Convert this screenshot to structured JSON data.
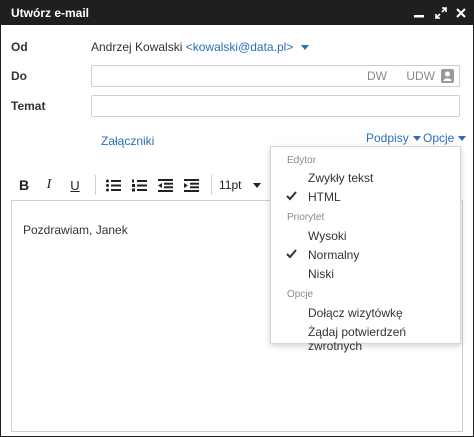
{
  "window": {
    "title": "Utwórz e-mail"
  },
  "from": {
    "label": "Od",
    "name": "Andrzej Kowalski",
    "email": "<kowalski@data.pl>"
  },
  "to": {
    "label": "Do",
    "value": "",
    "dw": "DW",
    "udw": "UDW"
  },
  "subject": {
    "label": "Temat",
    "value": ""
  },
  "attachments_link": "Załączniki",
  "signatures_link": "Podpisy",
  "options_link": "Opcje",
  "toolbar": {
    "font_size": "11pt"
  },
  "editor": {
    "body": "Pozdrawiam, Janek"
  },
  "options_menu": {
    "editor_header": "Edytor",
    "plain_text": "Zwykły tekst",
    "html": "HTML",
    "priority_header": "Priorytet",
    "priority_high": "Wysoki",
    "priority_normal": "Normalny",
    "priority_low": "Niski",
    "options_header": "Opcje",
    "attach_vcard": "Dołącz wizytówkę",
    "request_receipt": "Żądaj potwierdzeń zwrotnych"
  },
  "colors": {
    "titlebar": "#1f1f1f",
    "link": "#2a6ebb",
    "border": "#cfcfcf"
  }
}
